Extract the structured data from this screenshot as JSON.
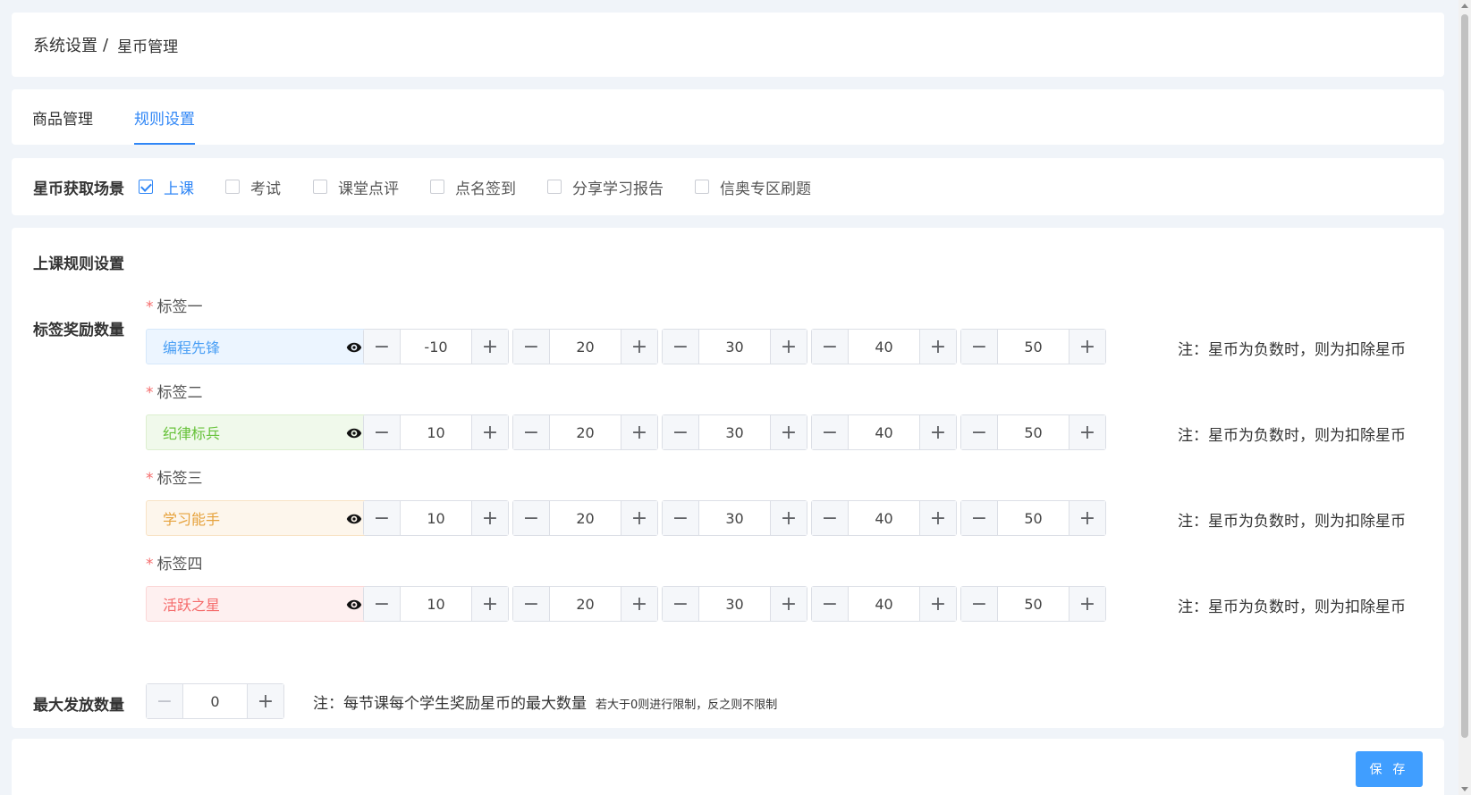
{
  "breadcrumb": {
    "parent": "系统设置",
    "separator": "/",
    "current": "星币管理"
  },
  "tabs": [
    {
      "label": "商品管理",
      "active": false
    },
    {
      "label": "规则设置",
      "active": true
    }
  ],
  "scenes": {
    "label": "星币获取场景",
    "options": [
      {
        "label": "上课",
        "checked": true
      },
      {
        "label": "考试",
        "checked": false
      },
      {
        "label": "课堂点评",
        "checked": false
      },
      {
        "label": "点名签到",
        "checked": false
      },
      {
        "label": "分享学习报告",
        "checked": false
      },
      {
        "label": "信奥专区刷题",
        "checked": false
      }
    ]
  },
  "rules": {
    "title": "上课规则设置",
    "reward_label": "标签奖励数量",
    "note": "注：星币为负数时，则为扣除星币",
    "tags": [
      {
        "title": "标签一",
        "name": "编程先锋",
        "color": "blue",
        "values": [
          "-10",
          "20",
          "30",
          "40",
          "50"
        ]
      },
      {
        "title": "标签二",
        "name": "纪律标兵",
        "color": "green",
        "values": [
          "10",
          "20",
          "30",
          "40",
          "50"
        ]
      },
      {
        "title": "标签三",
        "name": "学习能手",
        "color": "orange",
        "values": [
          "10",
          "20",
          "30",
          "40",
          "50"
        ]
      },
      {
        "title": "标签四",
        "name": "活跃之星",
        "color": "red",
        "values": [
          "10",
          "20",
          "30",
          "40",
          "50"
        ]
      }
    ],
    "max": {
      "label": "最大发放数量",
      "value": "0",
      "note": "注：每节课每个学生奖励星币的最大数量",
      "note_small": "若大于0则进行限制，反之则不限制"
    }
  },
  "footer": {
    "save_label": "保 存"
  },
  "icons": {
    "eye": "eye-icon",
    "minus": "−",
    "plus": "+",
    "required": "*"
  },
  "colors": {
    "accent": "#409eff",
    "active_tab": "#2f86f6",
    "required": "#f56c6c"
  }
}
